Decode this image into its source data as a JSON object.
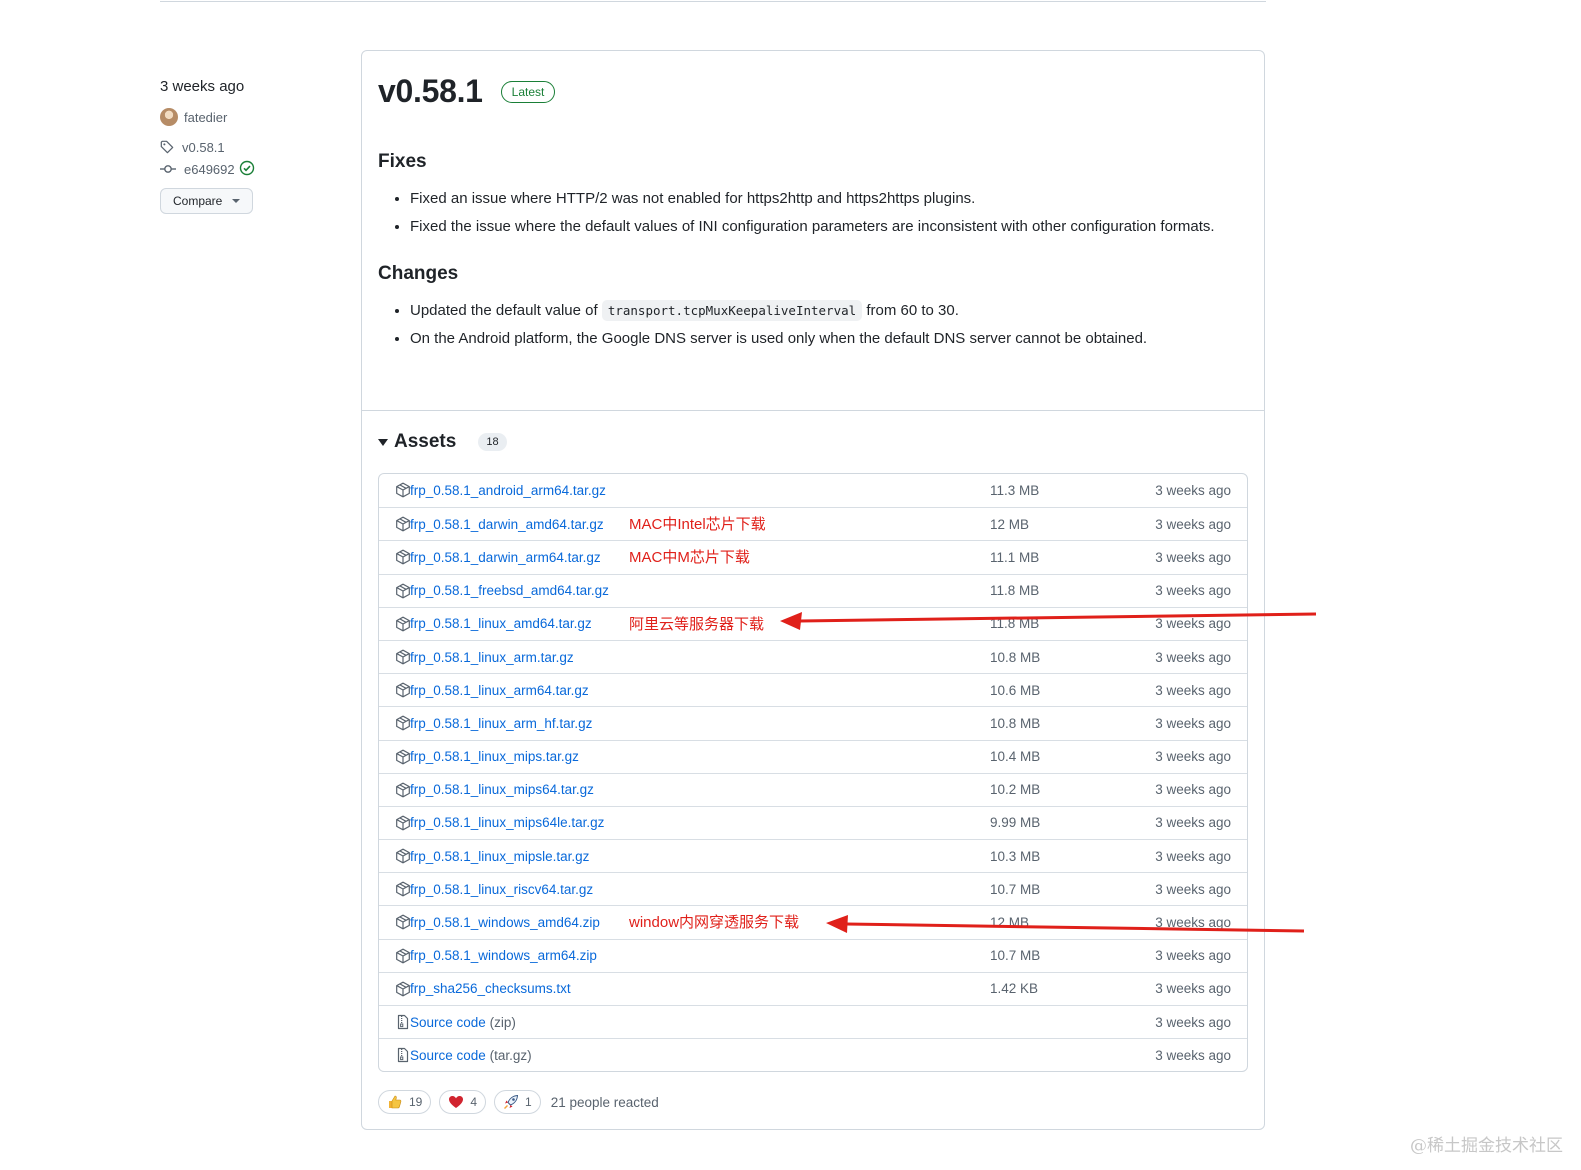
{
  "meta": {
    "date": "3 weeks ago",
    "author": "fatedier",
    "tag": "v0.58.1",
    "commit": "e649692",
    "compare_label": "Compare"
  },
  "release": {
    "title": "v0.58.1",
    "badge": "Latest",
    "fixes_heading": "Fixes",
    "fixes": [
      "Fixed an issue where HTTP/2 was not enabled for https2http and https2https plugins.",
      "Fixed the issue where the default values of INI configuration parameters are inconsistent with other configuration formats."
    ],
    "changes_heading": "Changes",
    "changes_1_pre": "Updated the default value of",
    "changes_1_code": "transport.tcpMuxKeepaliveInterval",
    "changes_1_post": "from 60 to 30.",
    "changes_2": "On the Android platform, the Google DNS server is used only when the default DNS server cannot be obtained."
  },
  "assets": {
    "heading": "Assets",
    "count": "18",
    "rows": [
      {
        "name": "frp_0.58.1_android_arm64.tar.gz",
        "size": "11.3 MB",
        "date": "3 weeks ago"
      },
      {
        "name": "frp_0.58.1_darwin_amd64.tar.gz",
        "size": "12 MB",
        "date": "3 weeks ago"
      },
      {
        "name": "frp_0.58.1_darwin_arm64.tar.gz",
        "size": "11.1 MB",
        "date": "3 weeks ago"
      },
      {
        "name": "frp_0.58.1_freebsd_amd64.tar.gz",
        "size": "11.8 MB",
        "date": "3 weeks ago"
      },
      {
        "name": "frp_0.58.1_linux_amd64.tar.gz",
        "size": "11.8 MB",
        "date": "3 weeks ago"
      },
      {
        "name": "frp_0.58.1_linux_arm.tar.gz",
        "size": "10.8 MB",
        "date": "3 weeks ago"
      },
      {
        "name": "frp_0.58.1_linux_arm64.tar.gz",
        "size": "10.6 MB",
        "date": "3 weeks ago"
      },
      {
        "name": "frp_0.58.1_linux_arm_hf.tar.gz",
        "size": "10.8 MB",
        "date": "3 weeks ago"
      },
      {
        "name": "frp_0.58.1_linux_mips.tar.gz",
        "size": "10.4 MB",
        "date": "3 weeks ago"
      },
      {
        "name": "frp_0.58.1_linux_mips64.tar.gz",
        "size": "10.2 MB",
        "date": "3 weeks ago"
      },
      {
        "name": "frp_0.58.1_linux_mips64le.tar.gz",
        "size": "9.99 MB",
        "date": "3 weeks ago"
      },
      {
        "name": "frp_0.58.1_linux_mipsle.tar.gz",
        "size": "10.3 MB",
        "date": "3 weeks ago"
      },
      {
        "name": "frp_0.58.1_linux_riscv64.tar.gz",
        "size": "10.7 MB",
        "date": "3 weeks ago"
      },
      {
        "name": "frp_0.58.1_windows_amd64.zip",
        "size": "12 MB",
        "date": "3 weeks ago"
      },
      {
        "name": "frp_0.58.1_windows_arm64.zip",
        "size": "10.7 MB",
        "date": "3 weeks ago"
      },
      {
        "name": "frp_sha256_checksums.txt",
        "size": "1.42 KB",
        "date": "3 weeks ago"
      }
    ],
    "source_zip": {
      "name": "Source code",
      "suffix": "(zip)",
      "date": "3 weeks ago"
    },
    "source_tar": {
      "name": "Source code",
      "suffix": "(tar.gz)",
      "date": "3 weeks ago"
    }
  },
  "annotations": {
    "mac_intel": "MAC中Intel芯片下载",
    "mac_m": "MAC中M芯片下载",
    "linux_server": "阿里云等服务器下载",
    "windows": "window内网穿透服务下载"
  },
  "reactions": {
    "thumbs": "19",
    "heart": "4",
    "rocket": "1",
    "summary": "21 people reacted"
  },
  "watermark": "@稀土掘金技术社区",
  "colors": {
    "link": "#0969da",
    "latest_green": "#1a7f37",
    "annotation_red": "#e0201a"
  }
}
